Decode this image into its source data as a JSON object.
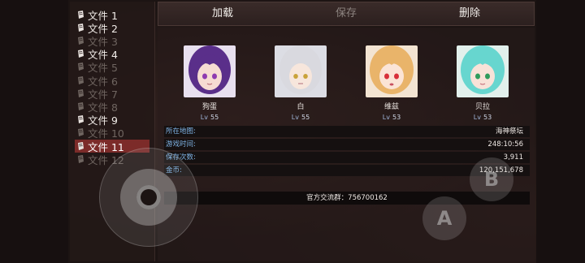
{
  "file_list": {
    "items": [
      {
        "label": "文件 1",
        "state": "saved"
      },
      {
        "label": "文件 2",
        "state": "saved"
      },
      {
        "label": "文件 3",
        "state": "empty"
      },
      {
        "label": "文件 4",
        "state": "saved"
      },
      {
        "label": "文件 5",
        "state": "empty"
      },
      {
        "label": "文件 6",
        "state": "empty"
      },
      {
        "label": "文件 7",
        "state": "empty"
      },
      {
        "label": "文件 8",
        "state": "empty"
      },
      {
        "label": "文件 9",
        "state": "saved"
      },
      {
        "label": "文件 10",
        "state": "empty"
      },
      {
        "label": "文件 11",
        "state": "selected"
      },
      {
        "label": "文件 12",
        "state": "empty"
      }
    ]
  },
  "toolbar": {
    "load_label": "加载",
    "save_label": "保存",
    "delete_label": "删除"
  },
  "party": [
    {
      "name": "狗蛋",
      "level_prefix": "Lv",
      "level": "55",
      "hair_color": "#5a2f8a"
    },
    {
      "name": "白",
      "level_prefix": "Lv",
      "level": "55",
      "hair_color": "#d9d9df"
    },
    {
      "name": "维兹",
      "level_prefix": "Lv",
      "level": "53",
      "hair_color": "#e9b46a"
    },
    {
      "name": "贝拉",
      "level_prefix": "Lv",
      "level": "53",
      "hair_color": "#67d6cf"
    }
  ],
  "save_info": {
    "map_label": "所在地图:",
    "map_value": "海神祭坛",
    "time_label": "游戏时间:",
    "time_value": "248:10:56",
    "count_label": "保存次数:",
    "count_value": "3,911",
    "gold_label": "金币:",
    "gold_value": "120,151,678"
  },
  "group_text": "官方交流群：756700162",
  "controls": {
    "a_label": "A",
    "b_label": "B"
  },
  "colors": {
    "selected_row": "#7c2b29",
    "info_label": "#7fb4e6"
  }
}
